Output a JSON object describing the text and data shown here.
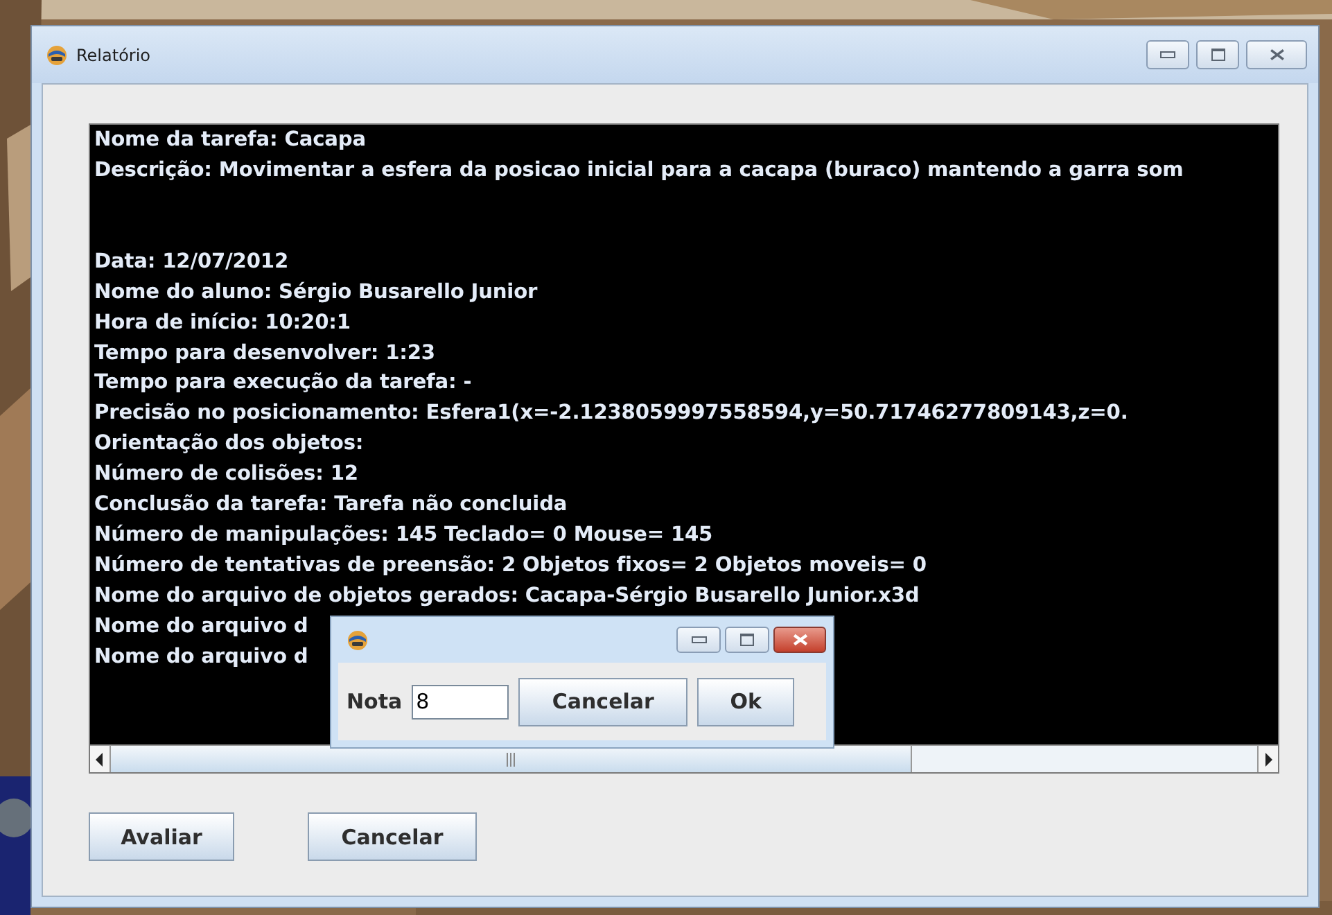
{
  "window": {
    "title": "Relatório"
  },
  "report": {
    "sections": [
      {
        "lines": [
          "Nome da tarefa: Cacapa",
          "Descrição: Movimentar a esfera da posicao inicial para a cacapa (buraco) mantendo a garra som"
        ]
      },
      {
        "lines": [
          "Data: 12/07/2012",
          "Nome do aluno: Sérgio Busarello Junior",
          "Hora de início: 10:20:1",
          "Tempo para desenvolver: 1:23",
          "Tempo para execução da tarefa: -",
          "Precisão no posicionamento: Esfera1(x=-2.1238059997558594,y=50.71746277809143,z=0.",
          "Orientação dos objetos:",
          "Número de colisões: 12",
          "Conclusão da tarefa: Tarefa não concluida",
          "Número de manipulações: 145 Teclado= 0 Mouse= 145",
          "Número de tentativas de preensão: 2 Objetos fixos= 2 Objetos moveis= 0",
          "Nome do arquivo de objetos gerados: Cacapa-Sérgio Busarello Junior.x3d",
          "Nome do arquivo d",
          "Nome do arquivo d"
        ]
      }
    ]
  },
  "dialog": {
    "field": {
      "label": "Nota",
      "value": "8"
    },
    "buttons": [
      "Cancelar",
      "Ok"
    ]
  },
  "buttons": [
    "Avaliar",
    "Cancelar"
  ]
}
